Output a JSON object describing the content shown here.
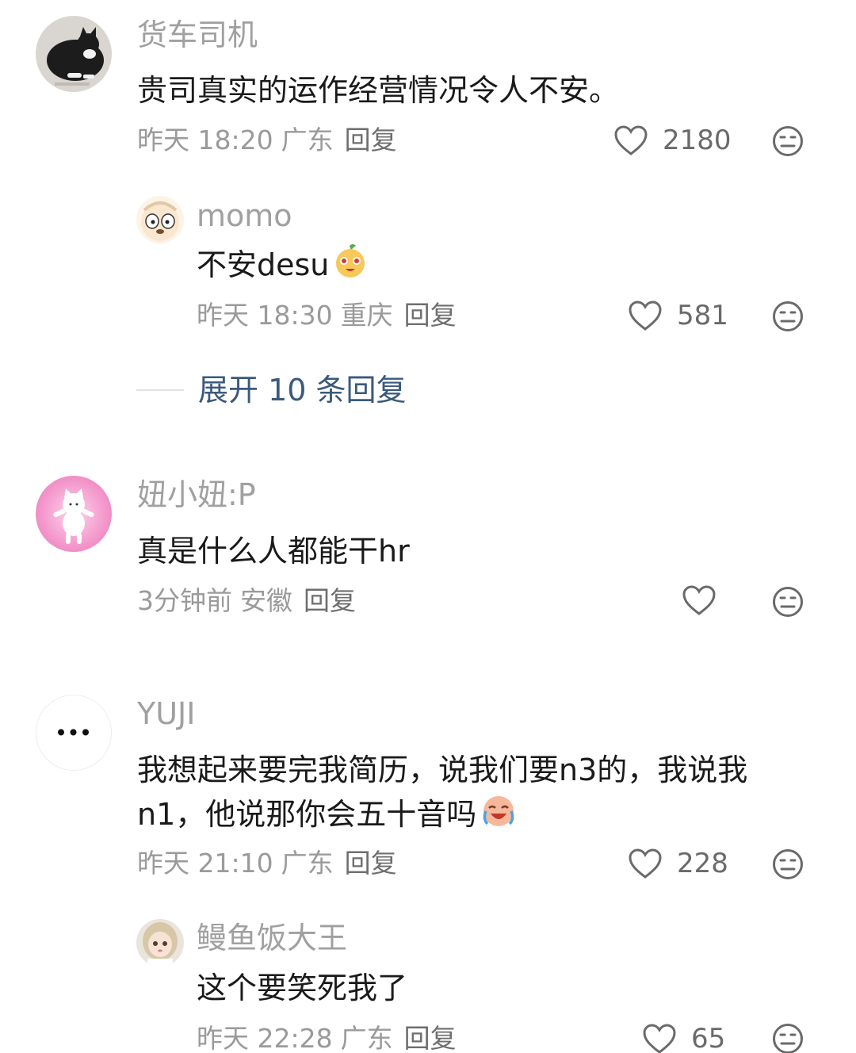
{
  "comments": [
    {
      "username": "货车司机",
      "text": "贵司真实的运作经营情况令人不安。",
      "time": "昨天 18:20",
      "location": "广东",
      "reply_label": "回复",
      "likes": "2180",
      "replies": [
        {
          "username": "momo",
          "text": "不安desu",
          "time": "昨天 18:30",
          "location": "重庆",
          "reply_label": "回复",
          "likes": "581"
        }
      ],
      "expand_label": "展开 10 条回复"
    },
    {
      "username": "妞小妞:P",
      "text": "真是什么人都能干hr",
      "time": "3分钟前",
      "location": "安徽",
      "reply_label": "回复",
      "likes": ""
    },
    {
      "username": "YUJI",
      "text_line1": "我想起来要完我简历，说我们要n3的，我说我",
      "text_line2": "n1，他说那你会五十音吗",
      "time": "昨天 21:10",
      "location": "广东",
      "reply_label": "回复",
      "likes": "228",
      "replies": [
        {
          "username": "鳗鱼饭大王",
          "text": "这个要笑死我了",
          "time": "昨天 22:28",
          "location": "广东",
          "reply_label": "回复",
          "likes": "65"
        }
      ]
    }
  ],
  "colors": {
    "username": "#a0a0a0",
    "text": "#1a1a1a",
    "meta": "#9a9a9a",
    "expand": "#3a5a7c"
  },
  "icons": [
    "heart-icon",
    "meh-face-icon",
    "laughing-emoji-icon",
    "crying-laughing-emoji-icon",
    "more-dots-icon"
  ]
}
